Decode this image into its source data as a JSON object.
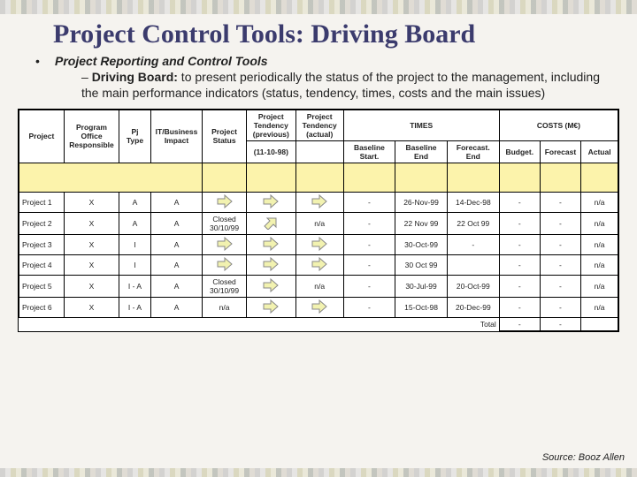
{
  "title": "Project Control Tools: Driving Board",
  "bullet_label": "Project Reporting and Control Tools",
  "sub_bullet_lead": "Driving Board:",
  "sub_bullet_text": " to present periodically the status of the project to the management, including the main performance indicators (status, tendency, times, costs and the main issues)",
  "source": "Source: Booz Allen",
  "headers": {
    "project": "Project",
    "responsible": "Program Office Responsible",
    "pj_type": "Pj Type",
    "impact": "IT/Business Impact",
    "status": "Project Status",
    "tend_prev": "Project Tendency (previous)",
    "tend_act": "Project Tendency (actual)",
    "ref_date": "(11-10-98)",
    "times": "TIMES",
    "costs": "COSTS (M€)",
    "baseline_start": "Baseline Start.",
    "baseline_end": "Baseline End",
    "forecast_end": "Forecast. End",
    "budget": "Budget.",
    "forecast": "Forecast",
    "actual": "Actual"
  },
  "rows": [
    {
      "project": "Project 1",
      "resp": "X",
      "pj": "A",
      "impact": "A",
      "status": "right-arrow",
      "prev": "right-arrow",
      "act": "right-arrow",
      "bs": "-",
      "be": "26-Nov-99",
      "fe": "14-Dec-98",
      "bud": "-",
      "fc": "-",
      "ac": "n/a"
    },
    {
      "project": "Project 2",
      "resp": "X",
      "pj": "A",
      "impact": "A",
      "status": "Closed 30/10/99",
      "prev": "up-arrow",
      "act": "n/a",
      "bs": "-",
      "be": "22 Nov 99",
      "fe": "22 Oct 99",
      "bud": "-",
      "fc": "-",
      "ac": "n/a"
    },
    {
      "project": "Project 3",
      "resp": "X",
      "pj": "I",
      "impact": "A",
      "status": "right-arrow",
      "prev": "right-arrow",
      "act": "right-arrow",
      "bs": "-",
      "be": "30-Oct-99",
      "fe": "-",
      "bud": "-",
      "fc": "-",
      "ac": "n/a"
    },
    {
      "project": "Project 4",
      "resp": "X",
      "pj": "I",
      "impact": "A",
      "status": "right-arrow",
      "prev": "right-arrow",
      "act": "right-arrow",
      "bs": "-",
      "be": "30 Oct 99",
      "fe": "",
      "bud": "-",
      "fc": "-",
      "ac": "n/a"
    },
    {
      "project": "Project 5",
      "resp": "X",
      "pj": "I - A",
      "impact": "A",
      "status": "Closed 30/10/99",
      "prev": "right-arrow",
      "act": "n/a",
      "bs": "-",
      "be": "30-Jul-99",
      "fe": "20-Oct-99",
      "bud": "-",
      "fc": "-",
      "ac": "n/a"
    },
    {
      "project": "Project 6",
      "resp": "X",
      "pj": "I - A",
      "impact": "A",
      "status": "n/a",
      "prev": "right-arrow",
      "act": "right-arrow",
      "bs": "-",
      "be": "15-Oct-98",
      "fe": "20-Dec-99",
      "bud": "-",
      "fc": "-",
      "ac": "n/a"
    }
  ],
  "total_label": "Total",
  "total_bud": "-",
  "total_fc": "-",
  "chart_data": {
    "type": "table",
    "title": "Driving Board",
    "columns": [
      "Project",
      "Program Office Responsible",
      "Pj Type",
      "IT/Business Impact",
      "Project Status",
      "Project Tendency (previous)",
      "Project Tendency (actual)",
      "Baseline Start.",
      "Baseline End",
      "Forecast. End",
      "Budget.",
      "Forecast",
      "Actual"
    ],
    "ref_date": "11-10-98",
    "rows": [
      [
        "Project 1",
        "X",
        "A",
        "A",
        "→",
        "→",
        "→",
        "-",
        "26-Nov-99",
        "14-Dec-98",
        "-",
        "-",
        "n/a"
      ],
      [
        "Project 2",
        "X",
        "A",
        "A",
        "Closed 30/10/99",
        "↗",
        "n/a",
        "-",
        "22 Nov 99",
        "22 Oct 99",
        "-",
        "-",
        "n/a"
      ],
      [
        "Project 3",
        "X",
        "I",
        "A",
        "→",
        "→",
        "→",
        "-",
        "30-Oct-99",
        "-",
        "-",
        "-",
        "n/a"
      ],
      [
        "Project 4",
        "X",
        "I",
        "A",
        "→",
        "→",
        "→",
        "-",
        "30 Oct 99",
        "",
        "-",
        "-",
        "n/a"
      ],
      [
        "Project 5",
        "X",
        "I - A",
        "A",
        "Closed 30/10/99",
        "→",
        "n/a",
        "-",
        "30-Jul-99",
        "20-Oct-99",
        "-",
        "-",
        "n/a"
      ],
      [
        "Project 6",
        "X",
        "I - A",
        "A",
        "n/a",
        "→",
        "→",
        "-",
        "15-Oct-98",
        "20-Dec-99",
        "-",
        "-",
        "n/a"
      ]
    ],
    "totals": {
      "Budget.": "-",
      "Forecast": "-"
    }
  }
}
